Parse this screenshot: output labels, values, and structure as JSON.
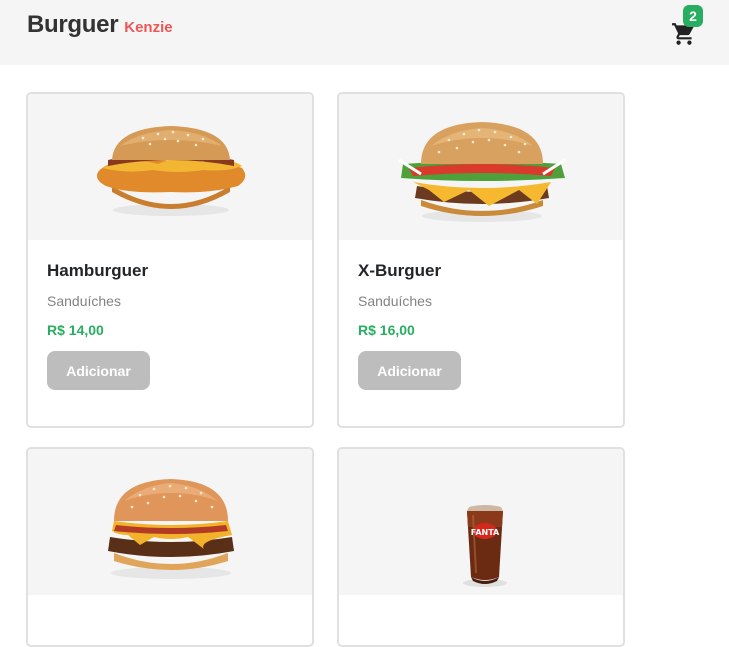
{
  "header": {
    "brand_main": "Burguer",
    "brand_sub": "Kenzie",
    "cart_count": "2",
    "cart_icon": "shopping-cart-icon"
  },
  "products": [
    {
      "name": "Hamburguer",
      "category": "Sanduíches",
      "price": "R$ 14,00",
      "button": "Adicionar",
      "image": "chicken-burger-image"
    },
    {
      "name": "X-Burguer",
      "category": "Sanduíches",
      "price": "R$ 16,00",
      "button": "Adicionar",
      "image": "cheeseburger-image"
    },
    {
      "name": "",
      "category": "",
      "price": "",
      "button": "",
      "image": "burger-image"
    },
    {
      "name": "",
      "category": "",
      "price": "",
      "button": "",
      "image": "soda-glass-image"
    }
  ],
  "colors": {
    "header_bg": "#f5f5f5",
    "brand_accent": "#eb5757",
    "badge": "#27ae60",
    "price": "#27ae60",
    "button_bg": "#bdbdbd",
    "card_border": "#e0e0e0"
  }
}
